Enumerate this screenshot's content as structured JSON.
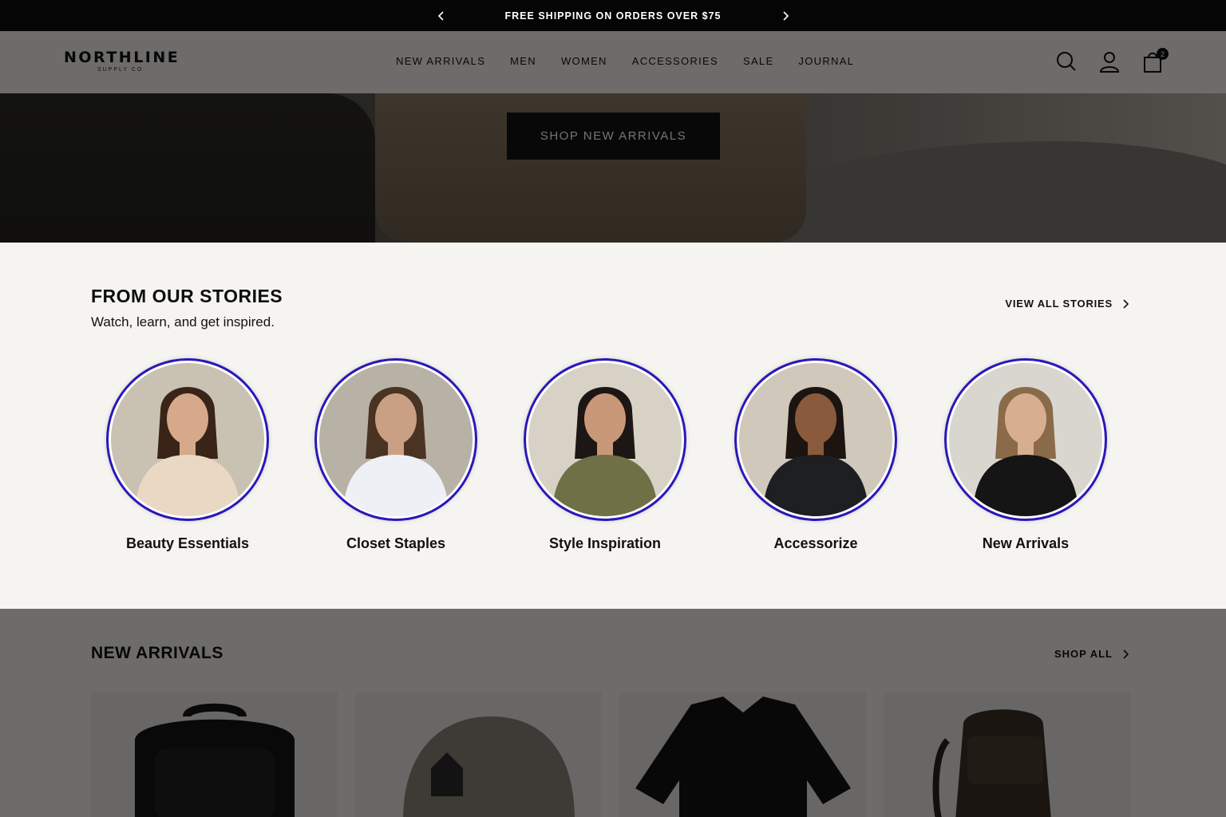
{
  "announcement": {
    "text": "FREE SHIPPING ON ORDERS OVER $75",
    "prev_icon": "chevron-left-icon",
    "next_icon": "chevron-right-icon"
  },
  "header": {
    "brand": "NORTHLINE",
    "brand_sub": "SUPPLY CO.",
    "nav": [
      "NEW ARRIVALS",
      "MEN",
      "WOMEN",
      "ACCESSORIES",
      "SALE",
      "JOURNAL"
    ],
    "icons": [
      "search-icon",
      "account-icon",
      "bag-icon"
    ],
    "cart_count": "2"
  },
  "hero": {
    "cta_label": "SHOP NEW ARRIVALS"
  },
  "stories": {
    "title": "FROM OUR STORIES",
    "subtitle": "Watch, learn, and get inspired.",
    "view_all": "VIEW ALL STORIES",
    "items": [
      {
        "label": "Beauty Essentials",
        "skin": "#d6a98a",
        "hair": "#3a2418",
        "top": "#e9d9c4",
        "bg": "#c9c2b3"
      },
      {
        "label": "Closet Staples",
        "skin": "#caa084",
        "hair": "#4a3322",
        "top": "#eef0f6",
        "bg": "#b8b2a6"
      },
      {
        "label": "Style Inspiration",
        "skin": "#c89878",
        "hair": "#1c1714",
        "top": "#6f7046",
        "bg": "#d8d2c6"
      },
      {
        "label": "Accessorize",
        "skin": "#8a5a3c",
        "hair": "#1b1411",
        "top": "#1e1f22",
        "bg": "#cfc8bb"
      },
      {
        "label": "New Arrivals",
        "skin": "#d8ae90",
        "hair": "#8a6a48",
        "top": "#151515",
        "bg": "#d9d6d0"
      }
    ]
  },
  "arrivals": {
    "title": "NEW ARRIVALS",
    "shop_all": "SHOP ALL"
  },
  "colors": {
    "ring": "#2a18b8",
    "announcement_bg": "#050505"
  }
}
